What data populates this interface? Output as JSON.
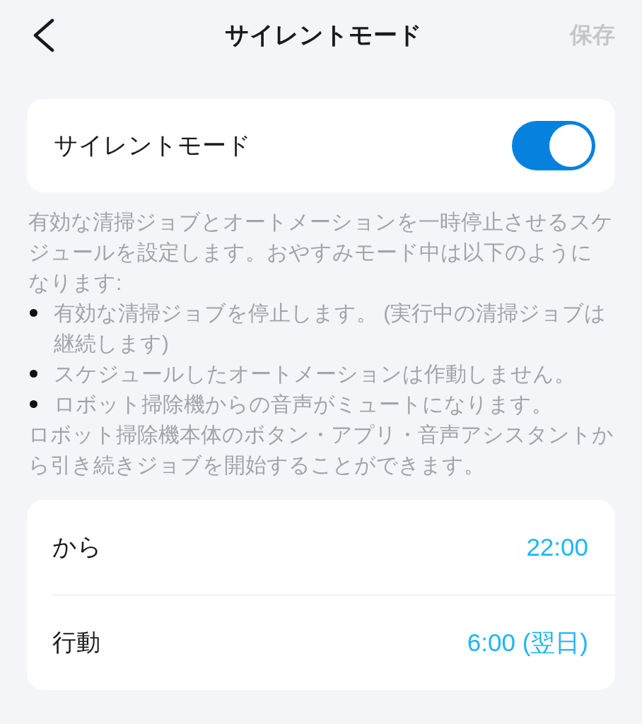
{
  "header": {
    "title": "サイレントモード",
    "save": {
      "label": "保存",
      "disabled": true
    }
  },
  "silent_mode": {
    "label": "サイレントモード",
    "on": true
  },
  "description": {
    "intro": "有効な清掃ジョブとオートメーションを一時停止させるスケジュールを設定します。おやすみモード中は以下のようになります:",
    "bullets": [
      "有効な清掃ジョブを停止します。 (実行中の清掃ジョブは継続します)",
      "スケジュールしたオートメーションは作動しません。",
      "ロボット掃除機からの音声がミュートになります。"
    ],
    "outro": "ロボット掃除機本体のボタン・アプリ・音声アシスタントから引き続きジョブを開始することができます。"
  },
  "schedule": [
    {
      "label": "から",
      "value": "22:00"
    },
    {
      "label": "行動",
      "value": "6:00 (翌日)"
    }
  ]
}
